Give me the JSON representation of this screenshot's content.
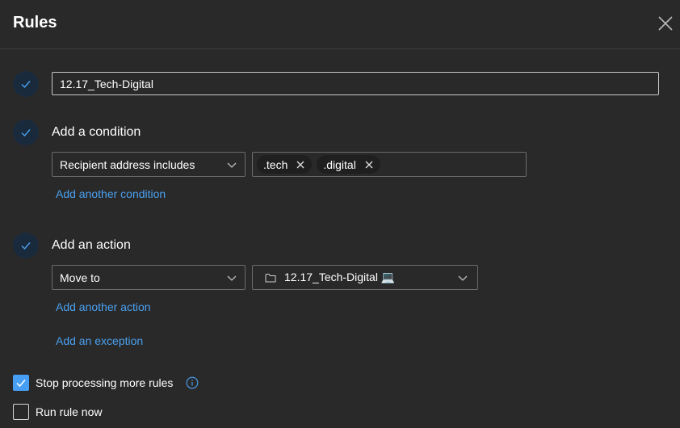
{
  "header": {
    "title": "Rules"
  },
  "rule_name": {
    "value": "12.17_Tech-Digital"
  },
  "condition": {
    "title": "Add a condition",
    "type_label": "Recipient address includes",
    "tags": [
      ".tech",
      ".digital"
    ],
    "add_link": "Add another condition"
  },
  "action": {
    "title": "Add an action",
    "type_label": "Move to",
    "folder_label": "12.17_Tech-Digital",
    "folder_emoji": "💻",
    "add_link": "Add another action"
  },
  "exception": {
    "add_link": "Add an exception"
  },
  "options": {
    "stop_processing": {
      "label": "Stop processing more rules",
      "checked": true
    },
    "run_now": {
      "label": "Run rule now",
      "checked": false
    }
  },
  "colors": {
    "accent": "#479ef5",
    "link": "#4aa0f0",
    "background": "#292929",
    "step_circle": "#1a2a3d"
  },
  "icons": [
    "close-icon",
    "checkmark-icon",
    "chevron-down-icon",
    "dismiss-icon",
    "folder-icon",
    "info-icon"
  ]
}
